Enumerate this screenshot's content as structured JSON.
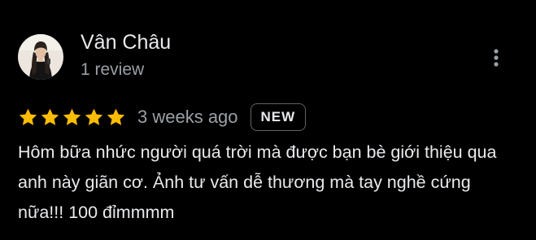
{
  "review": {
    "author_name": "Vân Châu",
    "author_meta": "1 review",
    "rating": 5,
    "max_rating": 5,
    "time_ago": "3 weeks ago",
    "badge": "NEW",
    "text": "Hôm bữa nhức người quá trời mà được bạn bè giới thiệu qua anh này giãn cơ. Ảnh tư vấn dễ thương mà tay nghề cứng nữa!!! 100 đỉmmmm"
  },
  "icons": {
    "star": "star-icon",
    "more": "more-vert-icon",
    "avatar": "avatar"
  },
  "colors": {
    "background": "#000000",
    "star": "#fbbc04",
    "primary_text": "#e8eaed",
    "secondary_text": "#9aa0a6",
    "badge_border": "#5f6368"
  }
}
